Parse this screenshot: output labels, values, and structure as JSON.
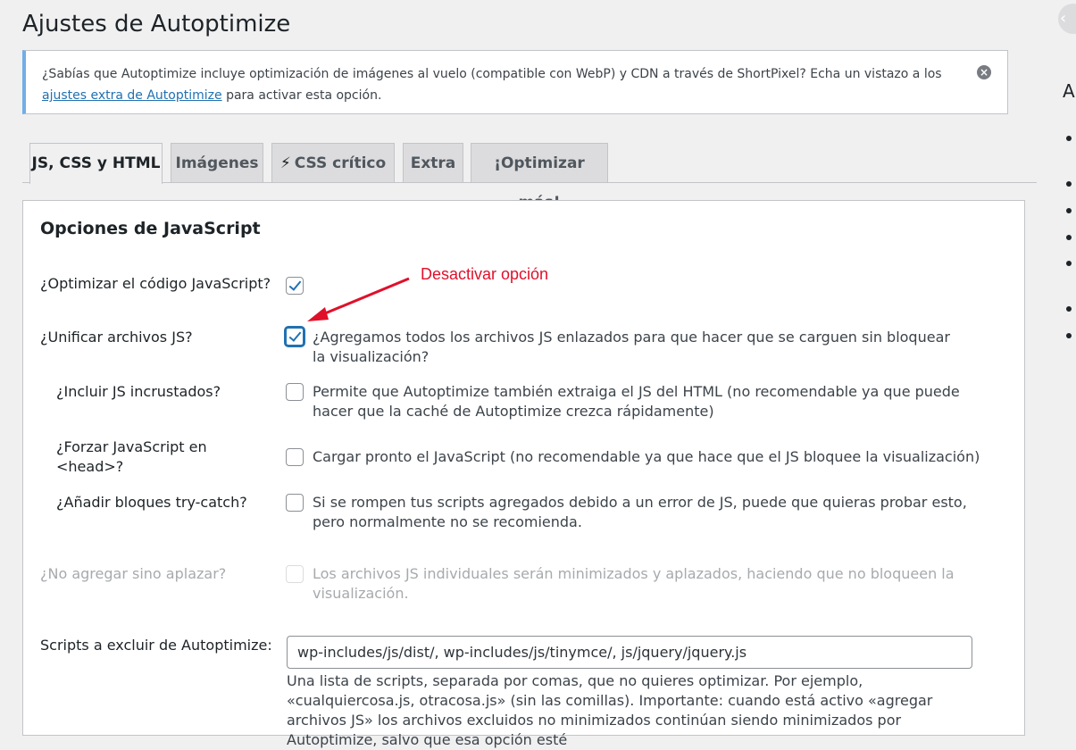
{
  "page": {
    "title": "Ajustes de Autoptimize"
  },
  "notice": {
    "text_before": "¿Sabías que Autoptimize incluye optimización de imágenes al vuelo (compatible con WebP) y CDN a través de ShortPixel? Echa un vistazo a los ",
    "link_text": "ajustes extra de Autoptimize",
    "text_after": " para activar esta opción.",
    "dismiss_icon": "×"
  },
  "tabs": [
    {
      "label": "JS, CSS y HTML",
      "active": true
    },
    {
      "label": "Imágenes"
    },
    {
      "label": "CSS crítico",
      "icon": "⚡"
    },
    {
      "label": "Extra"
    },
    {
      "label": "¡Optimizar más!"
    }
  ],
  "sidebar": {
    "heading_letter": "A",
    "collapse_icon": "‹"
  },
  "js_section": {
    "title": "Opciones de JavaScript",
    "rows": [
      {
        "label": "¿Optimizar el código JavaScript?",
        "checked": true,
        "description": ""
      },
      {
        "label": "¿Unificar archivos JS?",
        "checked": true,
        "description": "¿Agregamos todos los archivos JS enlazados para que hacer que se carguen sin bloquear la visualización?"
      },
      {
        "label": "¿Incluir JS incrustados?",
        "checked": false,
        "description": "Permite que Autoptimize también extraiga el JS del HTML (no recomendable ya que puede hacer que la caché de Autoptimize crezca rápidamente)"
      },
      {
        "label": "¿Forzar JavaScript en <head>?",
        "checked": false,
        "description": "Cargar pronto el JavaScript (no recomendable ya que hace que el JS bloquee la visualización)"
      },
      {
        "label": "¿Añadir bloques try-catch?",
        "checked": false,
        "description": "Si se rompen tus scripts agregados debido a un error de JS, puede que quieras probar esto, pero normalmente no se recomienda."
      },
      {
        "label": "¿No agregar sino aplazar?",
        "checked": false,
        "disabled": true,
        "description": "Los archivos JS individuales serán minimizados y aplazados, haciendo que no bloqueen la visualización."
      }
    ],
    "exclude": {
      "label": "Scripts a excluir de Autoptimize:",
      "value": "wp-includes/js/dist/, wp-includes/js/tinymce/, js/jquery/jquery.js",
      "help": "Una lista de scripts, separada por comas, que no quieres optimizar. Por ejemplo, «cualquiercosa.js, otracosa.js» (sin las comillas). Importante: cuando está activo «agregar archivos JS» los archivos excluidos no minimizados continúan siendo minimizados por Autoptimize, salvo que esa opción esté"
    }
  },
  "annotation": {
    "text": "Desactivar opción",
    "color": "#e0102a"
  }
}
